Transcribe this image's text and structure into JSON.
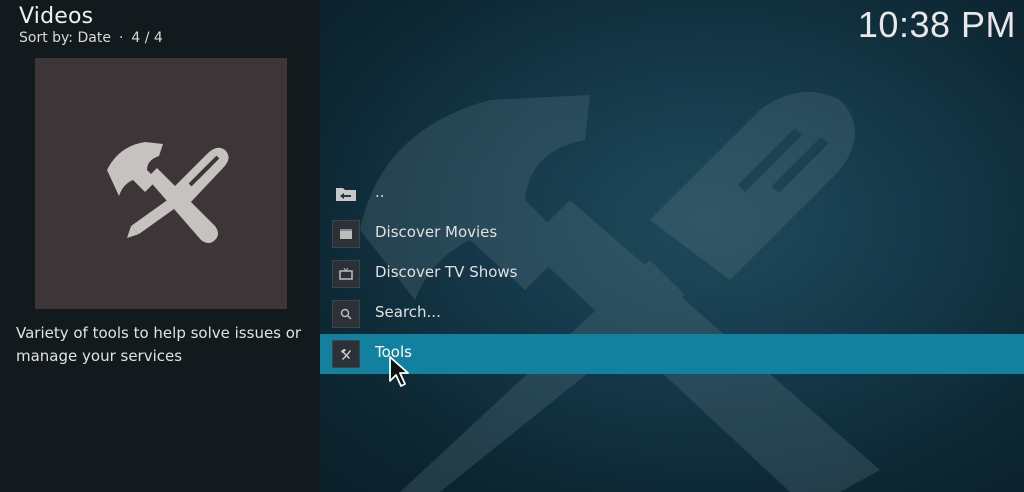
{
  "header": {
    "title": "Videos",
    "sort_label": "Sort by: Date",
    "count": "4 / 4"
  },
  "clock": "10:38 PM",
  "thumbnail": {
    "icon": "tools-icon",
    "bg_color": "#3d3538"
  },
  "description": "Variety of tools to help solve issues or manage your services",
  "list": {
    "items": [
      {
        "label": "..",
        "icon": "folder-back-icon"
      },
      {
        "label": "Discover Movies",
        "icon": "clapperboard-icon"
      },
      {
        "label": "Discover TV Shows",
        "icon": "tv-icon"
      },
      {
        "label": "Search...",
        "icon": "search-icon"
      },
      {
        "label": "Tools",
        "icon": "tools-icon",
        "selected": true
      }
    ]
  },
  "colors": {
    "selection": "#12819f",
    "left_panel": "#131a1e",
    "background": "#15394a"
  }
}
